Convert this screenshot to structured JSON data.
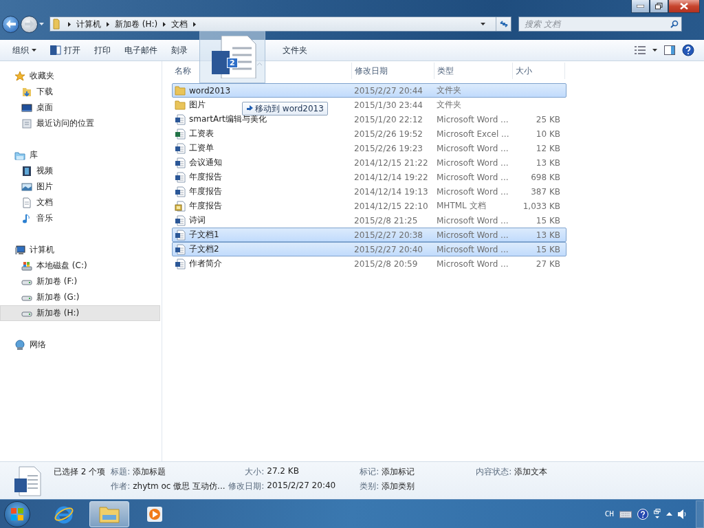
{
  "address_bar": {
    "breadcrumbs": [
      "计算机",
      "新加卷 (H:)",
      "文档"
    ]
  },
  "search": {
    "placeholder": "搜索 文档"
  },
  "toolbar": {
    "items": [
      {
        "label": "组织",
        "kind": "menu"
      },
      {
        "label": "打开",
        "kind": "open"
      },
      {
        "label": "打印",
        "kind": "plain"
      },
      {
        "label": "电子邮件",
        "kind": "plain"
      },
      {
        "label": "刻录",
        "kind": "plain"
      },
      {
        "label": "文件夹",
        "kind": "plain"
      }
    ]
  },
  "sidebar": {
    "groups": [
      {
        "label": "收藏夹",
        "kind": "star",
        "selected": false,
        "children": [
          {
            "label": "下载",
            "kind": "download",
            "selected": false
          },
          {
            "label": "桌面",
            "kind": "desktop",
            "selected": false
          },
          {
            "label": "最近访问的位置",
            "kind": "recent",
            "selected": false
          }
        ]
      },
      {
        "label": "库",
        "kind": "library",
        "selected": false,
        "children": [
          {
            "label": "视频",
            "kind": "video",
            "selected": false
          },
          {
            "label": "图片",
            "kind": "picture",
            "selected": false
          },
          {
            "label": "文档",
            "kind": "document",
            "selected": false
          },
          {
            "label": "音乐",
            "kind": "music",
            "selected": false
          }
        ]
      },
      {
        "label": "计算机",
        "kind": "computer",
        "selected": false,
        "children": [
          {
            "label": "本地磁盘 (C:)",
            "kind": "system-drive",
            "selected": false
          },
          {
            "label": "新加卷 (F:)",
            "kind": "drive",
            "selected": false
          },
          {
            "label": "新加卷 (G:)",
            "kind": "drive",
            "selected": false
          },
          {
            "label": "新加卷 (H:)",
            "kind": "drive",
            "selected": true
          }
        ]
      },
      {
        "label": "网络",
        "kind": "network",
        "selected": false
      }
    ]
  },
  "file_list": {
    "columns": [
      "名称",
      "修改日期",
      "类型",
      "大小"
    ],
    "rows": [
      {
        "kind": "folder",
        "name": "word2013",
        "date": "2015/2/27 20:44",
        "type": "文件夹",
        "selected": true
      },
      {
        "kind": "folder",
        "name": "图片",
        "date": "2015/1/30 23:44",
        "type": "文件夹",
        "selected": false
      },
      {
        "kind": "word",
        "name": "smartArt编辑与美化",
        "date": "2015/1/20 22:12",
        "type": "Microsoft Word ...",
        "size": "25 KB",
        "selected": false
      },
      {
        "kind": "excel",
        "name": "工资表",
        "date": "2015/2/26 19:52",
        "type": "Microsoft Excel ...",
        "size": "10 KB",
        "selected": false
      },
      {
        "kind": "word",
        "name": "工资单",
        "date": "2015/2/26 19:23",
        "type": "Microsoft Word ...",
        "size": "12 KB",
        "selected": false
      },
      {
        "kind": "word",
        "name": "会议通知",
        "date": "2014/12/15 21:22",
        "type": "Microsoft Word ...",
        "size": "13 KB",
        "selected": false
      },
      {
        "kind": "word",
        "name": "年度报告",
        "date": "2014/12/14 19:22",
        "type": "Microsoft Word ...",
        "size": "698 KB",
        "selected": false
      },
      {
        "kind": "word",
        "name": "年度报告",
        "date": "2014/12/14 19:13",
        "type": "Microsoft Word ...",
        "size": "387 KB",
        "selected": false
      },
      {
        "kind": "mhtml",
        "name": "年度报告",
        "date": "2014/12/15 22:10",
        "type": "MHTML 文档",
        "size": "1,033 KB",
        "selected": false
      },
      {
        "kind": "word",
        "name": "诗词",
        "date": "2015/2/8 21:25",
        "type": "Microsoft Word ...",
        "size": "15 KB",
        "selected": false
      },
      {
        "kind": "word",
        "name": "子文档1",
        "date": "2015/2/27 20:38",
        "type": "Microsoft Word ...",
        "size": "13 KB",
        "selected": true
      },
      {
        "kind": "word",
        "name": "子文档2",
        "date": "2015/2/27 20:40",
        "type": "Microsoft Word ...",
        "size": "15 KB",
        "selected": true
      },
      {
        "kind": "word",
        "name": "作者简介",
        "date": "2015/2/8 20:59",
        "type": "Microsoft Word ...",
        "size": "27 KB",
        "selected": false
      }
    ]
  },
  "drag": {
    "count": "2",
    "tooltip": "移动到 word2013"
  },
  "details": {
    "summary": "已选择 2 个项",
    "fields": [
      {
        "label": "标题:",
        "value": "添加标题"
      },
      {
        "label": "大小:",
        "value": "27.2 KB"
      },
      {
        "label": "标记:",
        "value": "添加标记"
      },
      {
        "label": "内容状态:",
        "value": "添加文本"
      },
      {
        "label": "作者:",
        "value": "zhytm oc 傲思  互动仿..."
      },
      {
        "label": "修改日期:",
        "value": "2015/2/27 20:40"
      },
      {
        "label": "类别:",
        "value": "添加类别"
      }
    ]
  },
  "taskbar": {
    "apps": [
      {
        "kind": "browser",
        "selected": false
      },
      {
        "kind": "explorer",
        "selected": true
      },
      {
        "kind": "player",
        "selected": false
      }
    ],
    "tray": {
      "language": "CH"
    }
  }
}
